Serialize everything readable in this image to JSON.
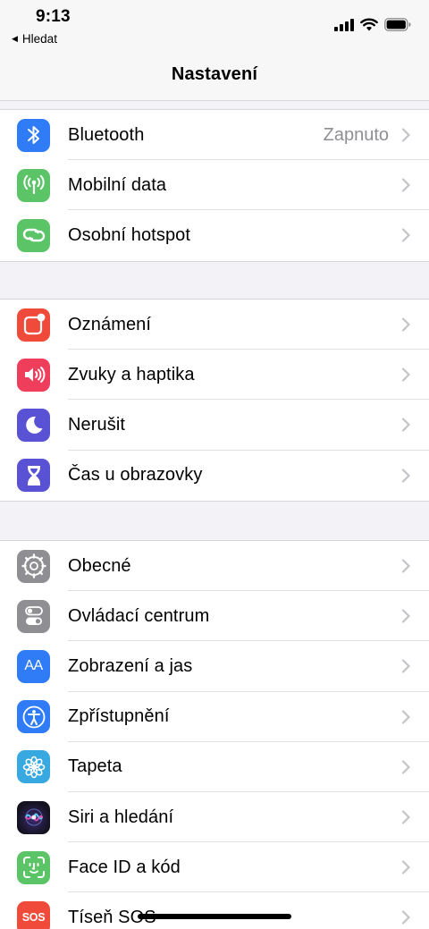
{
  "status_bar": {
    "time": "9:13",
    "back_label": "Hledat",
    "back_arrow": "◀",
    "icons": [
      "signal-icon",
      "wifi-icon",
      "battery-icon"
    ]
  },
  "nav": {
    "title": "Nastavení"
  },
  "sections": [
    {
      "items": [
        {
          "label": "Bluetooth",
          "value": "Zapnuto",
          "icon": "bluetooth-icon",
          "color": "#2f7cf6"
        },
        {
          "label": "Mobilní data",
          "icon": "antenna-icon",
          "color": "#5ac466"
        },
        {
          "label": "Osobní hotspot",
          "icon": "hotspot-link-icon",
          "color": "#5ac466"
        }
      ]
    },
    {
      "items": [
        {
          "label": "Oznámení",
          "icon": "notification-icon",
          "color": "#ef4a3a"
        },
        {
          "label": "Zvuky a haptika",
          "icon": "speaker-icon",
          "color": "#ee3e5c"
        },
        {
          "label": "Nerušit",
          "icon": "moon-icon",
          "color": "#5a52d4"
        },
        {
          "label": "Čas u obrazovky",
          "icon": "hourglass-icon",
          "color": "#5a52d4"
        }
      ]
    },
    {
      "items": [
        {
          "label": "Obecné",
          "icon": "gear-icon",
          "color": "#8e8e93"
        },
        {
          "label": "Ovládací centrum",
          "icon": "toggles-icon",
          "color": "#8e8e93"
        },
        {
          "label": "Zobrazení a jas",
          "icon": "text-size-icon",
          "color": "#2f7cf6",
          "glyph": "AA"
        },
        {
          "label": "Zpřístupnění",
          "icon": "accessibility-icon",
          "color": "#2f7cf6"
        },
        {
          "label": "Tapeta",
          "icon": "flower-icon",
          "color": "#37a9e0"
        },
        {
          "label": "Siri a hledání",
          "icon": "siri-icon",
          "color": "#1a1a2e"
        },
        {
          "label": "Face ID a kód",
          "icon": "face-id-icon",
          "color": "#5ac466"
        },
        {
          "label": "Tíseň SOS",
          "icon": "sos-icon",
          "color": "#ef4a3a",
          "glyph": "SOS"
        }
      ]
    }
  ]
}
